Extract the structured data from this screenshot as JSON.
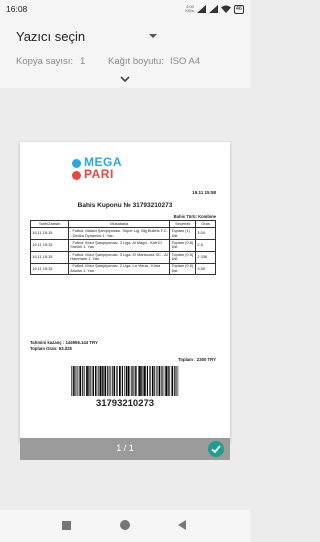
{
  "status_bar": {
    "time": "16:08",
    "net_speed_value": "4.00",
    "net_speed_unit": "KB/s",
    "battery": "46"
  },
  "header": {
    "printer_name": "Yazıcı seçin",
    "copies_label": "Kopya sayısı:",
    "copies_value": "1",
    "paper_label": "Kağıt boyutu:",
    "paper_value": "ISO A4"
  },
  "ticket": {
    "logo_line1": "MEGA",
    "logo_line2": "PARI",
    "date": "19.11 15:58",
    "title": "Bahis Kuponu № 31793210273",
    "bet_type": "Bahis Türü: Kombine",
    "table_headers": [
      "Tarih/Zaman",
      "Müsabaka",
      "Seçenek",
      "Oran"
    ],
    "rows": [
      {
        "date": "19.11 15:15",
        "match": ". Futbol. Malavi Şampiyonası. Süper Lig. Big Bullets F.C. - Dedza Dynamos 1. Yarı",
        "selection": "Toplam (1) Üst",
        "odds": "3.04"
      },
      {
        "date": "19.11 15:15",
        "match": ". Futbol. Mısır Şampiyonası. 3 Liga. Al Magd - Kafr El Sheikh 1. Yarı",
        "selection": "Toplam (0.5) Üst",
        "odds": "2.5"
      },
      {
        "date": "19.11 15:15",
        "match": ". Futbol. Mısır Şampiyonası. 3 Liga. El Mansoura SC - Al Hammam 1. Yarı",
        "selection": "Toplam (0.5) Üst",
        "odds": "2.336"
      },
      {
        "date": "19.11 15:15",
        "match": ". Futbol. Mısır Şampiyonası. 2 Liga. La Viena - Kima Aswan 1. Yarı",
        "selection": "Toplam (0.5) Üst",
        "odds": "3.55"
      }
    ],
    "estimated_win": "Tahmini kazanç : 144956.144 TRY",
    "total_odds": "Toplam Oran: 63.025",
    "total": "Toplam : 2300 TRY",
    "barcode_number": "31793210273"
  },
  "preview": {
    "page_indicator": "1 / 1"
  },
  "icons": {
    "dropdown": "dropdown-arrow-icon",
    "expand": "chevron-down-icon",
    "done": "check-circle-icon",
    "nav": [
      "recent-apps-icon",
      "home-icon",
      "back-icon"
    ]
  },
  "colors": {
    "accent": "#1e9e8c",
    "logo_blue": "#2aa7e1",
    "logo_red": "#e8463f"
  }
}
